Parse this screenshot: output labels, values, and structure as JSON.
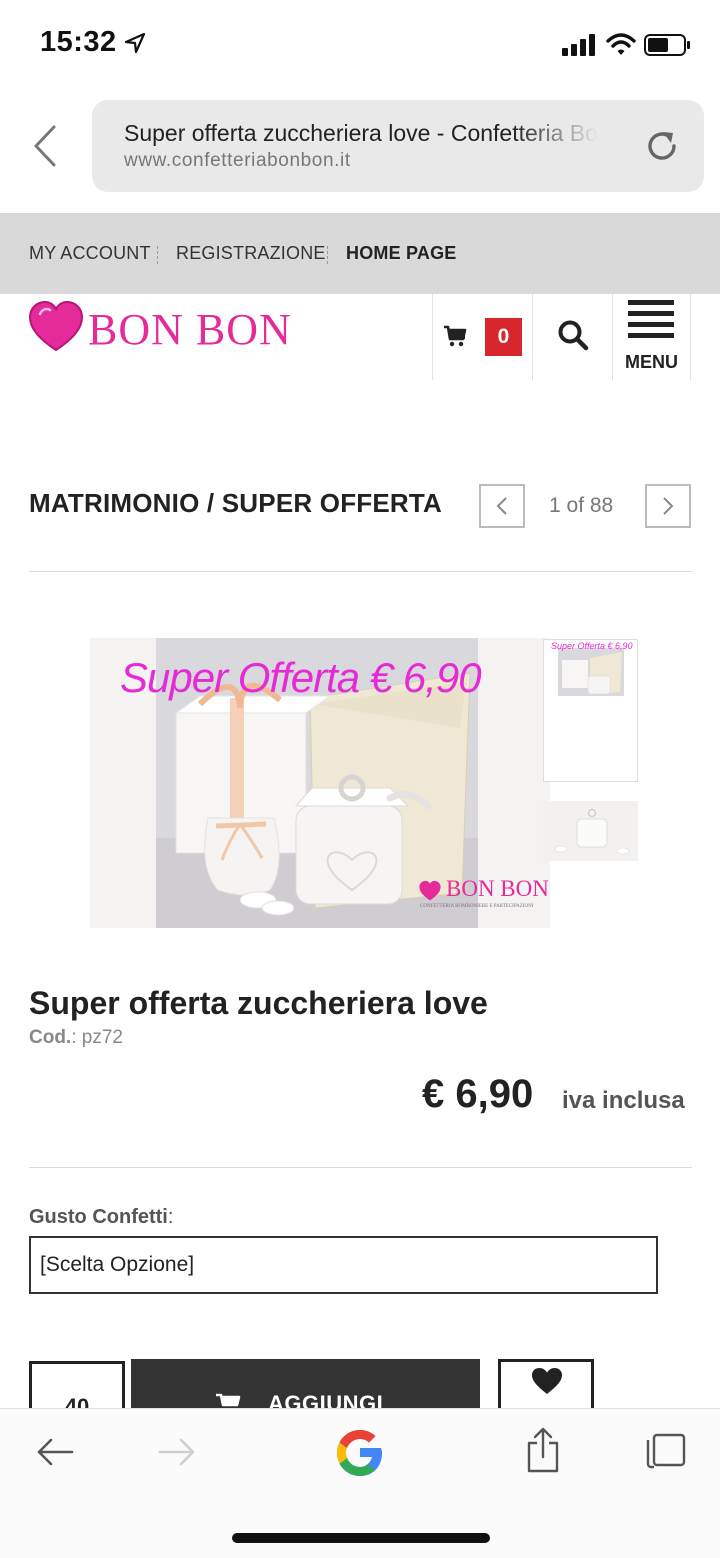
{
  "status_bar": {
    "time": "15:32"
  },
  "browser": {
    "page_title": "Super offerta zuccheriera love - Confetteria Bon Bon",
    "domain": "www.confetteriabonbon.it"
  },
  "top_nav": {
    "my_account": "MY ACCOUNT",
    "registration": "REGISTRAZIONE",
    "home_page": "HOME PAGE"
  },
  "header": {
    "logo_text": "BON BON",
    "cart_count": "0",
    "menu_label": "MENU"
  },
  "breadcrumb": {
    "text": "MATRIMONIO / SUPER OFFERTA",
    "pager": "1 of 88"
  },
  "gallery": {
    "overlay_text": "Super Offerta € 6,90",
    "watermark_logo": "BON BON",
    "watermark_tagline": "CONFETTERIA BOMBONIERE E PARTECIPAZIONI",
    "thumb_overlay": "Super Offerta € 6,90"
  },
  "product": {
    "title": "Super offerta zuccheriera love",
    "code_label": "Cod.",
    "code_value": ": pz72",
    "price": "€ 6,90",
    "vat_note": "iva inclusa"
  },
  "options": {
    "label": "Gusto Confetti",
    "label_suffix": ":",
    "select_value": "[Scelta Opzione]"
  },
  "purchase": {
    "quantity": "40",
    "add_label": "AGGIUNGI"
  },
  "colors": {
    "brand_pink": "#e52a9a",
    "offer_magenta": "#e52ad6",
    "cart_badge": "#d7262c",
    "button_dark": "#333333"
  }
}
